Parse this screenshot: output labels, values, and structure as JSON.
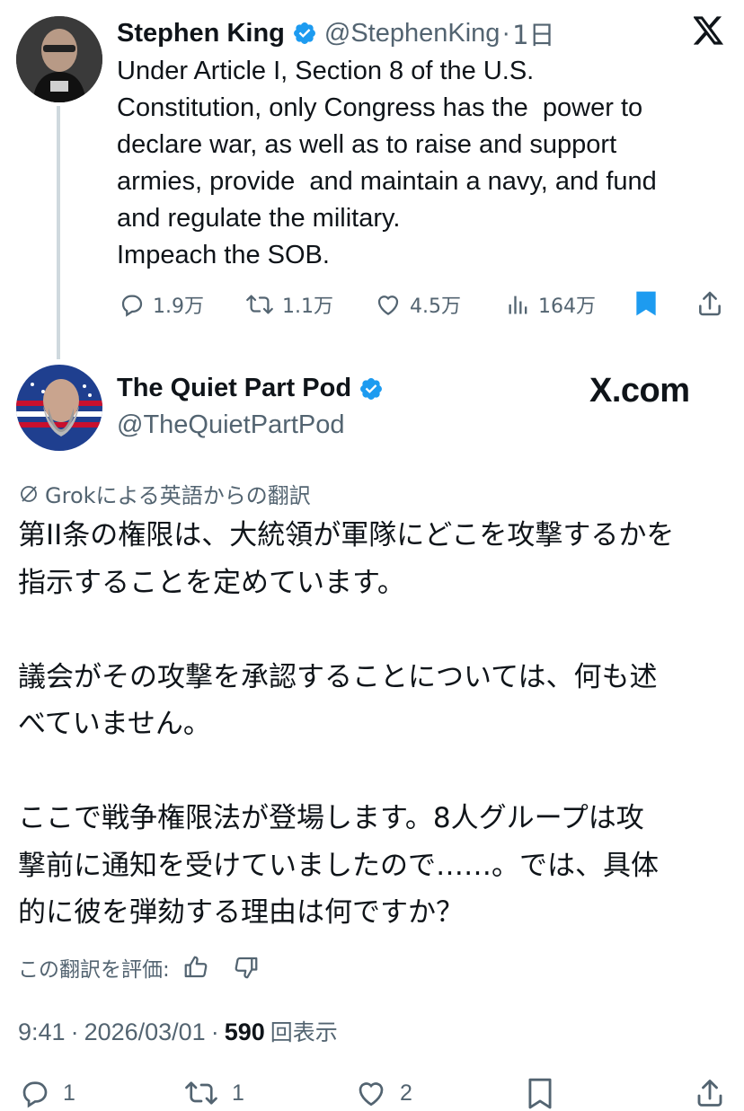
{
  "colors": {
    "verified": "#1d9bf0",
    "bookmark": "#1d9bf0",
    "secondary": "#536471",
    "line": "#cfd9de"
  },
  "icons": [
    "verified-badge-icon",
    "x-logo-icon",
    "reply-icon",
    "repost-icon",
    "like-icon",
    "views-icon",
    "bookmark-icon",
    "share-icon",
    "translate-icon",
    "thumbs-up-icon",
    "thumbs-down-icon"
  ],
  "parent_tweet": {
    "display_name": "Stephen King",
    "handle": "@StephenKing",
    "separator": "·",
    "time": "1日",
    "text": "Under Article I, Section 8 of the U.S.\nConstitution, only Congress has the  power to\ndeclare war, as well as to raise and support\narmies, provide  and maintain a navy, and fund\nand regulate the military.\nImpeach the SOB.",
    "replies": "1.9万",
    "reposts": "1.1万",
    "likes": "4.5万",
    "views": "164万",
    "bookmarked": true
  },
  "reply_tweet": {
    "display_name": "The Quiet Part Pod",
    "handle": "@TheQuietPartPod",
    "watermark": "X.com",
    "translation_label": "Grokによる英語からの翻訳",
    "text": "第II条の権限は、大統領が軍隊にどこを攻撃するかを\n指示することを定めています。\n\n議会がその攻撃を承認することについては、何も述\nべていません。\n\nここで戦争権限法が登場します。8人グループは攻\n撃前に通知を受けていましたので……。では、具体\n的に彼を弾劾する理由は何ですか？",
    "rate_label": "この翻訳を評価:",
    "time": "9:41",
    "date": "2026/03/01",
    "meta_sep": "·",
    "views_count": "590",
    "views_label": "回表示",
    "replies": "1",
    "reposts": "1",
    "likes": "2"
  }
}
